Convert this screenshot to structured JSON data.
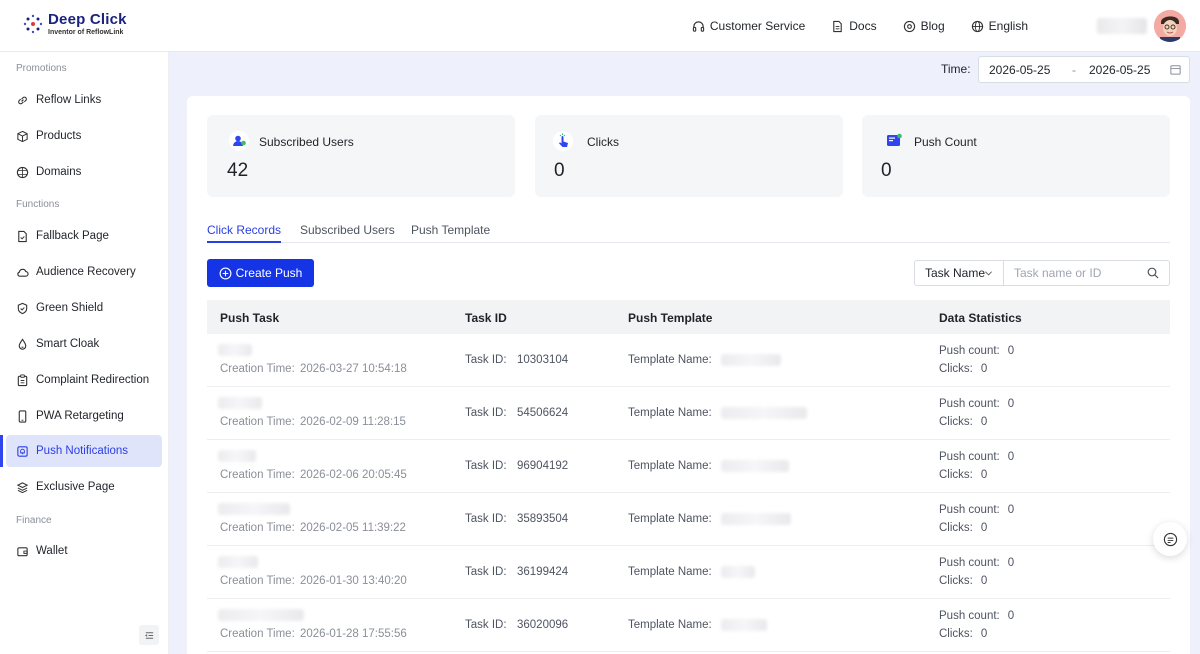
{
  "brand": {
    "name": "Deep Click",
    "tagline": "Inventor of ReflowLink"
  },
  "header": {
    "nav": [
      {
        "label": "Customer Service",
        "icon": "headset-icon"
      },
      {
        "label": "Docs",
        "icon": "document-icon"
      },
      {
        "label": "Blog",
        "icon": "blog-icon"
      },
      {
        "label": "English",
        "icon": "globe-icon"
      }
    ]
  },
  "sidebar": {
    "sections": {
      "promotions": "Promotions",
      "functions": "Functions",
      "finance": "Finance"
    },
    "items": [
      {
        "label": "Reflow Links",
        "icon": "link-icon"
      },
      {
        "label": "Products",
        "icon": "box-icon"
      },
      {
        "label": "Domains",
        "icon": "globe-icon"
      },
      {
        "label": "Fallback Page",
        "icon": "page-icon"
      },
      {
        "label": "Audience Recovery",
        "icon": "cloud-icon"
      },
      {
        "label": "Green Shield",
        "icon": "shield-icon"
      },
      {
        "label": "Smart Cloak",
        "icon": "drop-icon"
      },
      {
        "label": "Complaint Redirection",
        "icon": "clipboard-icon"
      },
      {
        "label": "PWA Retargeting",
        "icon": "phone-icon"
      },
      {
        "label": "Push Notifications",
        "icon": "push-icon",
        "active": true
      },
      {
        "label": "Exclusive Page",
        "icon": "stack-icon"
      },
      {
        "label": "Wallet",
        "icon": "wallet-icon"
      }
    ]
  },
  "filters": {
    "time_label": "Time:",
    "date_start": "2026-05-25",
    "date_sep": "-",
    "date_end": "2026-05-25"
  },
  "stats": [
    {
      "label": "Subscribed Users",
      "value": "42",
      "icon": "user-icon"
    },
    {
      "label": "Clicks",
      "value": "0",
      "icon": "click-icon"
    },
    {
      "label": "Push Count",
      "value": "0",
      "icon": "push-count-icon"
    }
  ],
  "tabs": [
    "Click Records",
    "Subscribed Users",
    "Push Template"
  ],
  "actions": {
    "create_push": "Create Push",
    "search_select": "Task Name",
    "search_placeholder": "Task name or ID"
  },
  "table": {
    "columns": [
      "Push Task",
      "Task ID",
      "Push Template",
      "Data Statistics"
    ],
    "creation_label": "Creation Time:",
    "task_id_label": "Task ID:",
    "template_label": "Template Name:",
    "push_count_label": "Push count:",
    "clicks_label": "Clicks:",
    "rows": [
      {
        "created": "2026-03-27 10:54:18",
        "task_id": "10303104",
        "push_count": "0",
        "clicks": "0"
      },
      {
        "created": "2026-02-09 11:28:15",
        "task_id": "54506624",
        "push_count": "0",
        "clicks": "0"
      },
      {
        "created": "2026-02-06 20:05:45",
        "task_id": "96904192",
        "push_count": "0",
        "clicks": "0"
      },
      {
        "created": "2026-02-05 11:39:22",
        "task_id": "35893504",
        "push_count": "0",
        "clicks": "0"
      },
      {
        "created": "2026-01-30 13:40:20",
        "task_id": "36199424",
        "push_count": "0",
        "clicks": "0"
      },
      {
        "created": "2026-01-28 17:55:56",
        "task_id": "36020096",
        "push_count": "0",
        "clicks": "0"
      }
    ]
  },
  "colors": {
    "accent": "#1434e6",
    "active_bg": "#dfe4fb",
    "page_bg": "#eef1fb"
  }
}
